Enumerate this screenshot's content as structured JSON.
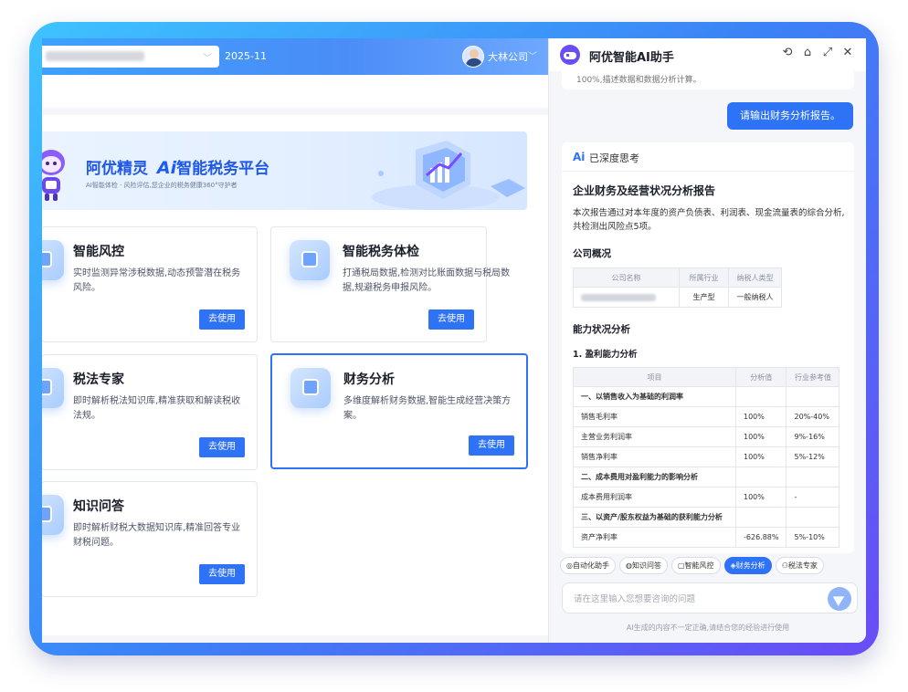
{
  "topbar": {
    "date": "2025-11",
    "user_name": "大林公司"
  },
  "banner": {
    "title_prefix": "阿优精灵",
    "ai_mark": "Ai",
    "title_suffix": "智能税务平台",
    "subtitle": "AI智能体检 · 风险评估,您企业的税务健康360°守护者"
  },
  "cards": [
    {
      "title": "智能风控",
      "desc": "实时监测异常涉税数据,动态预警潜在税务风险。",
      "button": "去使用"
    },
    {
      "title": "智能税务体检",
      "desc": "打通税局数据,检测对比账面数据与税局数据,规避税务申报风险。",
      "button": "去使用"
    },
    {
      "title": "税法专家",
      "desc": "即时解析税法知识库,精准获取和解读税收法规。",
      "button": "去使用"
    },
    {
      "title": "财务分析",
      "desc": "多维度解析财务数据,智能生成经营决策方案。",
      "button": "去使用"
    },
    {
      "title": "知识问答",
      "desc": "即时解析财税大数据知识库,精准回答专业财税问题。",
      "button": "去使用"
    }
  ],
  "panel": {
    "title": "阿优智能AI助手",
    "prev_msg": "100%,描述数据和数据分析计算。",
    "user_message": "请输出财务分析报告。",
    "think_ai": "Ai",
    "think_label": "已深度思考",
    "report": {
      "title": "企业财务及经营状况分析报告",
      "intro": "本次报告通过对本年度的资产负债表、利润表、现金流量表的综合分析,共检测出风险点5项。",
      "company_section": "公司概况",
      "company_headers": [
        "公司名称",
        "所属行业",
        "纳税人类型"
      ],
      "company_row": [
        "生产型",
        "一般纳税人"
      ],
      "ability_section": "能力状况分析",
      "profit_subsection": "1. 盈利能力分析",
      "metric_headers": [
        "项目",
        "分析值",
        "行业参考值"
      ],
      "metric_rows": [
        {
          "item": "一、以销售收入为基础的利润率",
          "value": "",
          "ref": "",
          "cat": true
        },
        {
          "item": "销售毛利率",
          "value": "100%",
          "ref": "20%-40%",
          "cat": false
        },
        {
          "item": "主营业务利润率",
          "value": "100%",
          "ref": "9%-16%",
          "cat": false
        },
        {
          "item": "销售净利率",
          "value": "100%",
          "ref": "5%-12%",
          "cat": false
        },
        {
          "item": "二、成本费用对盈利能力的影响分析",
          "value": "",
          "ref": "",
          "cat": true
        },
        {
          "item": "成本费用利润率",
          "value": "100%",
          "ref": "-",
          "cat": false
        },
        {
          "item": "三、以资产/股东权益为基础的获利能力分析",
          "value": "",
          "ref": "",
          "cat": true
        },
        {
          "item": "资产净利率",
          "value": "-626.88%",
          "ref": "5%-10%",
          "cat": false
        }
      ]
    },
    "chips": [
      "自动化助手",
      "知识问答",
      "智能风控",
      "财务分析",
      "税法专家"
    ],
    "active_chip": "财务分析",
    "input_placeholder": "请在这里输入您想要咨询的问题",
    "disclaimer": "AI生成的内容不一定正确,请结合您的经验进行使用"
  },
  "colors": {
    "accent": "#2e72f6",
    "brand_purple": "#6b4cf5"
  },
  "icons": {
    "header": [
      "history-icon",
      "home-icon",
      "expand-icon",
      "close-icon"
    ]
  }
}
